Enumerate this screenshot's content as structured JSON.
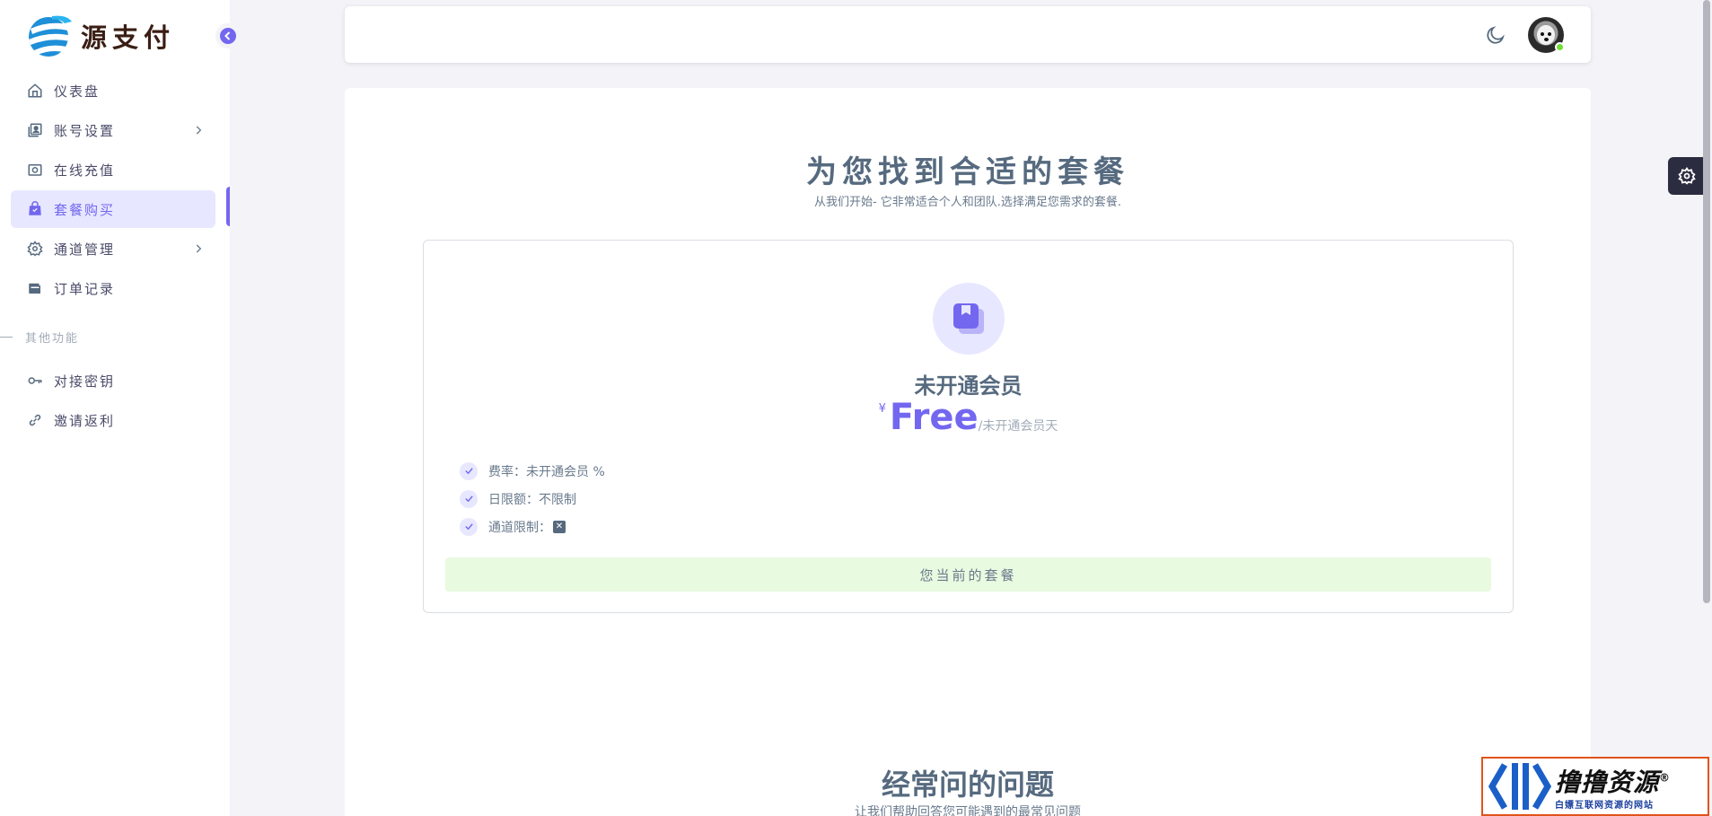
{
  "brand": {
    "name": "源支付"
  },
  "sidebar": {
    "items": [
      {
        "label": "仪表盘",
        "icon": "home-icon",
        "has_submenu": false,
        "active": false
      },
      {
        "label": "账号设置",
        "icon": "user-card-icon",
        "has_submenu": true,
        "active": false
      },
      {
        "label": "在线充值",
        "icon": "camera-icon",
        "has_submenu": false,
        "active": false
      },
      {
        "label": "套餐购买",
        "icon": "shopping-bag-icon",
        "has_submenu": false,
        "active": true
      },
      {
        "label": "通道管理",
        "icon": "gear-icon",
        "has_submenu": true,
        "active": false
      },
      {
        "label": "订单记录",
        "icon": "wallet-icon",
        "has_submenu": false,
        "active": false
      }
    ],
    "section_header": "其他功能",
    "other_items": [
      {
        "label": "对接密钥",
        "icon": "key-icon"
      },
      {
        "label": "邀请返利",
        "icon": "link-icon"
      }
    ]
  },
  "main": {
    "title": "为您找到合适的套餐",
    "subtitle": "从我们开始- 它非常适合个人和团队.选择满足您需求的套餐.",
    "plan": {
      "name": "未开通会员",
      "currency": "¥",
      "price": "Free",
      "period": "/未开通会员天",
      "features": [
        {
          "label": "费率：",
          "value": "未开通会员 %"
        },
        {
          "label": "日限额：",
          "value": "不限制"
        },
        {
          "label": "通道限制：",
          "value": ""
        }
      ],
      "button_label": "您当前的套餐"
    },
    "faq": {
      "title": "经常问的问题",
      "subtitle": "让我们帮助回答您可能遇到的最常见问题"
    }
  },
  "watermark": {
    "main": "撸撸资源",
    "registered": "®",
    "sub": "白嫖互联网资源的网站"
  },
  "colors": {
    "primary": "#7367f0",
    "primary_light": "#e7e7ff",
    "success_light": "#e8fadf",
    "text": "#566a7f",
    "background": "#f4f3f8"
  }
}
